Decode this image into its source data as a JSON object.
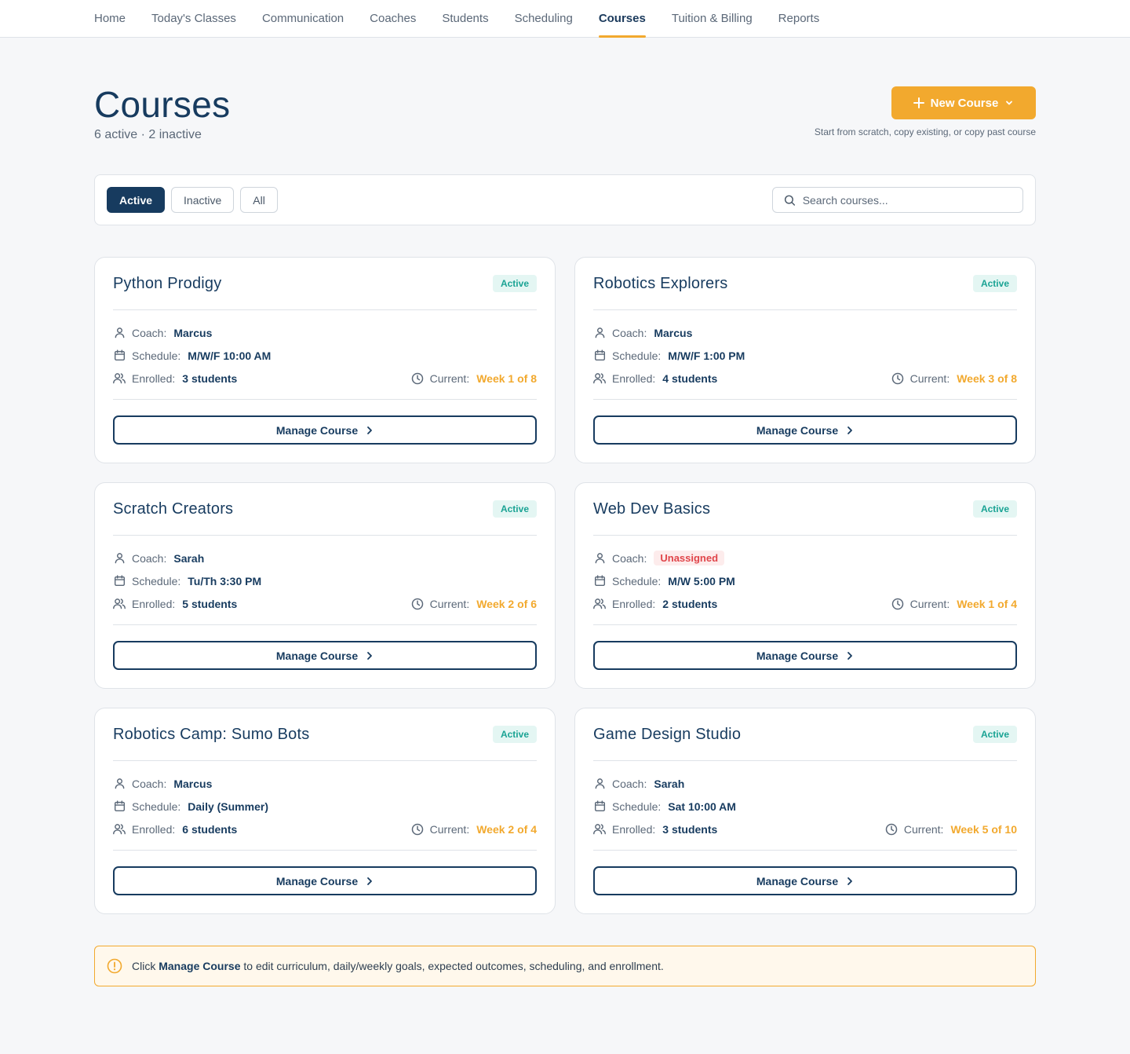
{
  "nav": {
    "items": [
      {
        "label": "Home",
        "active": false
      },
      {
        "label": "Today's Classes",
        "active": false
      },
      {
        "label": "Communication",
        "active": false
      },
      {
        "label": "Coaches",
        "active": false
      },
      {
        "label": "Students",
        "active": false
      },
      {
        "label": "Scheduling",
        "active": false
      },
      {
        "label": "Courses",
        "active": true
      },
      {
        "label": "Tuition & Billing",
        "active": false
      },
      {
        "label": "Reports",
        "active": false
      }
    ]
  },
  "header": {
    "title": "Courses",
    "subtitle": "6 active · 2 inactive",
    "new_course_label": "New Course",
    "new_course_hint": "Start from scratch, copy existing, or copy past course"
  },
  "filters": {
    "tabs": [
      {
        "label": "Active",
        "active": true
      },
      {
        "label": "Inactive",
        "active": false
      },
      {
        "label": "All",
        "active": false
      }
    ],
    "search_placeholder": "Search courses..."
  },
  "labels": {
    "coach": "Coach:",
    "schedule": "Schedule:",
    "enrolled": "Enrolled:",
    "current": "Current:",
    "manage": "Manage Course"
  },
  "courses": [
    {
      "title": "Python Prodigy",
      "status": "Active",
      "coach": "Marcus",
      "coach_unassigned": false,
      "schedule": "M/W/F 10:00 AM",
      "enrolled": "3 students",
      "current": "Week 1 of 8"
    },
    {
      "title": "Robotics Explorers",
      "status": "Active",
      "coach": "Marcus",
      "coach_unassigned": false,
      "schedule": "M/W/F 1:00 PM",
      "enrolled": "4 students",
      "current": "Week 3 of 8"
    },
    {
      "title": "Scratch Creators",
      "status": "Active",
      "coach": "Sarah",
      "coach_unassigned": false,
      "schedule": "Tu/Th 3:30 PM",
      "enrolled": "5 students",
      "current": "Week 2 of 6"
    },
    {
      "title": "Web Dev Basics",
      "status": "Active",
      "coach": "Unassigned",
      "coach_unassigned": true,
      "schedule": "M/W 5:00 PM",
      "enrolled": "2 students",
      "current": "Week 1 of 4"
    },
    {
      "title": "Robotics Camp: Sumo Bots",
      "status": "Active",
      "coach": "Marcus",
      "coach_unassigned": false,
      "schedule": "Daily (Summer)",
      "enrolled": "6 students",
      "current": "Week 2 of 4"
    },
    {
      "title": "Game Design Studio",
      "status": "Active",
      "coach": "Sarah",
      "coach_unassigned": false,
      "schedule": "Sat 10:00 AM",
      "enrolled": "3 students",
      "current": "Week 5 of 10"
    }
  ],
  "info": {
    "prefix": "Click",
    "bold": "Manage Course",
    "suffix": "to edit curriculum, daily/weekly goals, expected outcomes, scheduling, and enrollment."
  },
  "colors": {
    "primary": "#173b5f",
    "accent": "#f2a92e",
    "active_badge": "#1aa394",
    "danger": "#e0454a"
  }
}
